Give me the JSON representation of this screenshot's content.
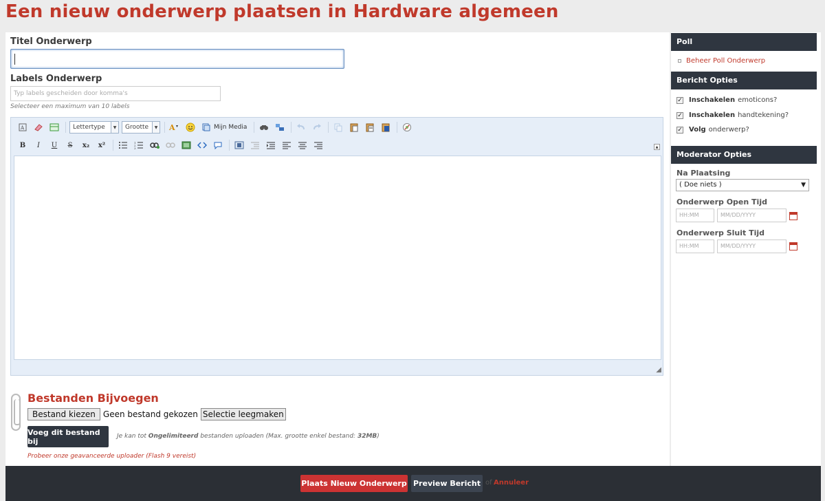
{
  "page": {
    "title": "Een nieuw onderwerp plaatsen in Hardware algemeen"
  },
  "form": {
    "title_label": "Titel Onderwerp",
    "title_value": "",
    "labels_label": "Labels Onderwerp",
    "labels_placeholder": "Typ labels gescheiden door komma's",
    "labels_hint": "Selecteer een maximum van 10 labels"
  },
  "editor": {
    "font_select": "Lettertype",
    "size_select": "Grootte",
    "my_media": "Mijn Media",
    "format_buttons": [
      "B",
      "I",
      "U",
      "S",
      "x₂",
      "x²"
    ]
  },
  "attachments": {
    "title": "Bestanden Bijvoegen",
    "choose_file": "Bestand kiezen",
    "no_file": "Geen bestand gekozen",
    "clear_selection": "Selectie leegmaken",
    "upload_button": "Voeg dit bestand bij",
    "upload_info_pre": "Je kan tot",
    "upload_info_unlimited": "Ongelimiteerd",
    "upload_info_mid": "bestanden uploaden (Max. grootte enkel bestand:",
    "upload_info_size": "32MB",
    "upload_info_post": ")",
    "advanced_link": "Probeer onze geavanceerde uploader (Flash 9 vereist)"
  },
  "sidebar": {
    "poll_header": "Poll",
    "poll_link": "Beheer Poll Onderwerp",
    "options_header": "Bericht Opties",
    "options": [
      {
        "strong": "Inschakelen",
        "text": "emoticons?",
        "checked": true
      },
      {
        "strong": "Inschakelen",
        "text": "handtekening?",
        "checked": true
      },
      {
        "strong": "Volg",
        "text": "onderwerp?",
        "checked": true
      }
    ],
    "moderator_header": "Moderator Opties",
    "after_post_label": "Na Plaatsing",
    "after_post_value": "( Doe niets )",
    "open_time_label": "Onderwerp Open Tijd",
    "close_time_label": "Onderwerp Sluit Tijd",
    "time_placeholder": "HH:MM",
    "date_placeholder": "MM/DD/YYYY"
  },
  "footer": {
    "submit": "Plaats Nieuw Onderwerp",
    "preview": "Preview Bericht",
    "or": "of",
    "cancel": "Annuleer"
  },
  "colors": {
    "accent": "#c0392b",
    "dark": "#2f3640"
  }
}
